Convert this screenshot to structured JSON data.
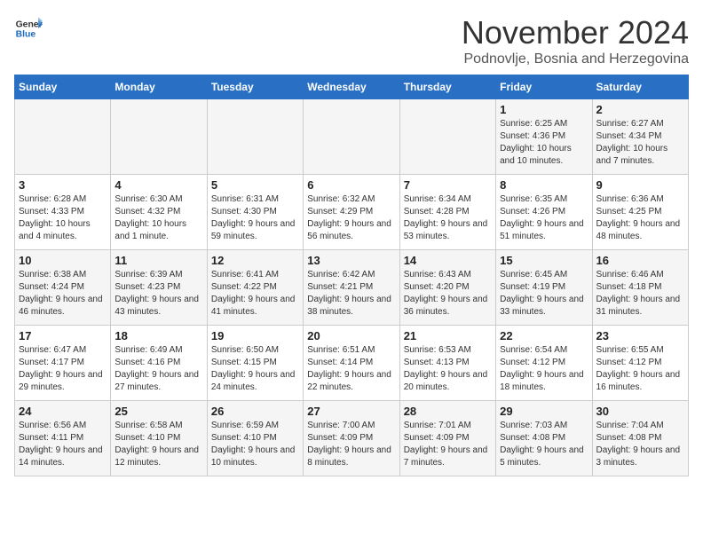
{
  "header": {
    "logo_general": "General",
    "logo_blue": "Blue",
    "month_title": "November 2024",
    "location": "Podnovlje, Bosnia and Herzegovina"
  },
  "days_of_week": [
    "Sunday",
    "Monday",
    "Tuesday",
    "Wednesday",
    "Thursday",
    "Friday",
    "Saturday"
  ],
  "weeks": [
    [
      {
        "day": "",
        "info": ""
      },
      {
        "day": "",
        "info": ""
      },
      {
        "day": "",
        "info": ""
      },
      {
        "day": "",
        "info": ""
      },
      {
        "day": "",
        "info": ""
      },
      {
        "day": "1",
        "info": "Sunrise: 6:25 AM\nSunset: 4:36 PM\nDaylight: 10 hours and 10 minutes."
      },
      {
        "day": "2",
        "info": "Sunrise: 6:27 AM\nSunset: 4:34 PM\nDaylight: 10 hours and 7 minutes."
      }
    ],
    [
      {
        "day": "3",
        "info": "Sunrise: 6:28 AM\nSunset: 4:33 PM\nDaylight: 10 hours and 4 minutes."
      },
      {
        "day": "4",
        "info": "Sunrise: 6:30 AM\nSunset: 4:32 PM\nDaylight: 10 hours and 1 minute."
      },
      {
        "day": "5",
        "info": "Sunrise: 6:31 AM\nSunset: 4:30 PM\nDaylight: 9 hours and 59 minutes."
      },
      {
        "day": "6",
        "info": "Sunrise: 6:32 AM\nSunset: 4:29 PM\nDaylight: 9 hours and 56 minutes."
      },
      {
        "day": "7",
        "info": "Sunrise: 6:34 AM\nSunset: 4:28 PM\nDaylight: 9 hours and 53 minutes."
      },
      {
        "day": "8",
        "info": "Sunrise: 6:35 AM\nSunset: 4:26 PM\nDaylight: 9 hours and 51 minutes."
      },
      {
        "day": "9",
        "info": "Sunrise: 6:36 AM\nSunset: 4:25 PM\nDaylight: 9 hours and 48 minutes."
      }
    ],
    [
      {
        "day": "10",
        "info": "Sunrise: 6:38 AM\nSunset: 4:24 PM\nDaylight: 9 hours and 46 minutes."
      },
      {
        "day": "11",
        "info": "Sunrise: 6:39 AM\nSunset: 4:23 PM\nDaylight: 9 hours and 43 minutes."
      },
      {
        "day": "12",
        "info": "Sunrise: 6:41 AM\nSunset: 4:22 PM\nDaylight: 9 hours and 41 minutes."
      },
      {
        "day": "13",
        "info": "Sunrise: 6:42 AM\nSunset: 4:21 PM\nDaylight: 9 hours and 38 minutes."
      },
      {
        "day": "14",
        "info": "Sunrise: 6:43 AM\nSunset: 4:20 PM\nDaylight: 9 hours and 36 minutes."
      },
      {
        "day": "15",
        "info": "Sunrise: 6:45 AM\nSunset: 4:19 PM\nDaylight: 9 hours and 33 minutes."
      },
      {
        "day": "16",
        "info": "Sunrise: 6:46 AM\nSunset: 4:18 PM\nDaylight: 9 hours and 31 minutes."
      }
    ],
    [
      {
        "day": "17",
        "info": "Sunrise: 6:47 AM\nSunset: 4:17 PM\nDaylight: 9 hours and 29 minutes."
      },
      {
        "day": "18",
        "info": "Sunrise: 6:49 AM\nSunset: 4:16 PM\nDaylight: 9 hours and 27 minutes."
      },
      {
        "day": "19",
        "info": "Sunrise: 6:50 AM\nSunset: 4:15 PM\nDaylight: 9 hours and 24 minutes."
      },
      {
        "day": "20",
        "info": "Sunrise: 6:51 AM\nSunset: 4:14 PM\nDaylight: 9 hours and 22 minutes."
      },
      {
        "day": "21",
        "info": "Sunrise: 6:53 AM\nSunset: 4:13 PM\nDaylight: 9 hours and 20 minutes."
      },
      {
        "day": "22",
        "info": "Sunrise: 6:54 AM\nSunset: 4:12 PM\nDaylight: 9 hours and 18 minutes."
      },
      {
        "day": "23",
        "info": "Sunrise: 6:55 AM\nSunset: 4:12 PM\nDaylight: 9 hours and 16 minutes."
      }
    ],
    [
      {
        "day": "24",
        "info": "Sunrise: 6:56 AM\nSunset: 4:11 PM\nDaylight: 9 hours and 14 minutes."
      },
      {
        "day": "25",
        "info": "Sunrise: 6:58 AM\nSunset: 4:10 PM\nDaylight: 9 hours and 12 minutes."
      },
      {
        "day": "26",
        "info": "Sunrise: 6:59 AM\nSunset: 4:10 PM\nDaylight: 9 hours and 10 minutes."
      },
      {
        "day": "27",
        "info": "Sunrise: 7:00 AM\nSunset: 4:09 PM\nDaylight: 9 hours and 8 minutes."
      },
      {
        "day": "28",
        "info": "Sunrise: 7:01 AM\nSunset: 4:09 PM\nDaylight: 9 hours and 7 minutes."
      },
      {
        "day": "29",
        "info": "Sunrise: 7:03 AM\nSunset: 4:08 PM\nDaylight: 9 hours and 5 minutes."
      },
      {
        "day": "30",
        "info": "Sunrise: 7:04 AM\nSunset: 4:08 PM\nDaylight: 9 hours and 3 minutes."
      }
    ]
  ]
}
